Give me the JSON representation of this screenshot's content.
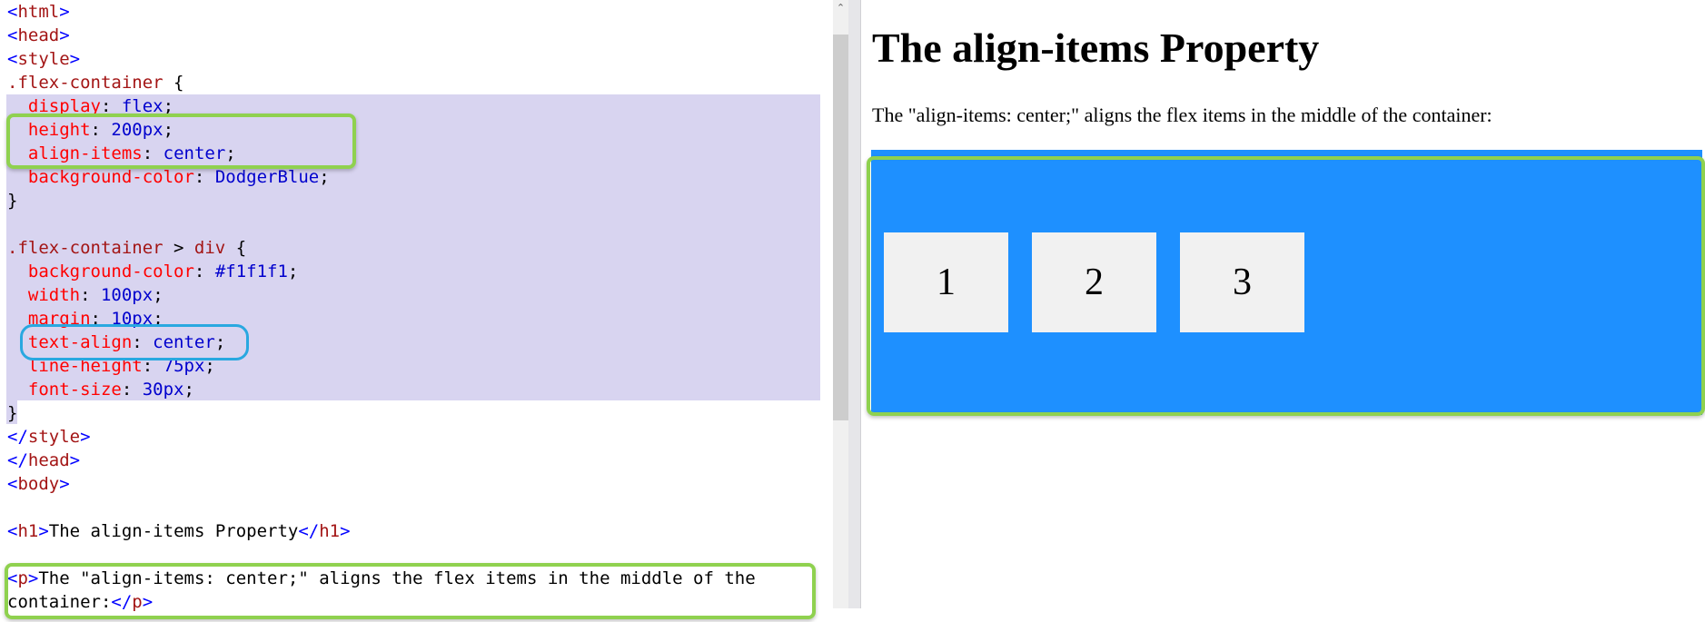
{
  "editor": {
    "lines": [
      [
        {
          "c": "b",
          "t": "<"
        },
        {
          "c": "g",
          "t": "html"
        },
        {
          "c": "b",
          "t": ">"
        }
      ],
      [
        {
          "c": "b",
          "t": "<"
        },
        {
          "c": "g",
          "t": "head"
        },
        {
          "c": "b",
          "t": ">"
        }
      ],
      [
        {
          "c": "b",
          "t": "<"
        },
        {
          "c": "g",
          "t": "style"
        },
        {
          "c": "b",
          "t": ">"
        }
      ],
      [
        {
          "c": "s",
          "t": ".flex-container"
        },
        {
          "c": "x",
          "t": " {"
        }
      ],
      [
        {
          "c": "x",
          "t": "  "
        },
        {
          "c": "p",
          "t": "display"
        },
        {
          "c": "x",
          "t": ": "
        },
        {
          "c": "v",
          "t": "flex"
        },
        {
          "c": "x",
          "t": ";"
        }
      ],
      [
        {
          "c": "x",
          "t": "  "
        },
        {
          "c": "p",
          "t": "height"
        },
        {
          "c": "x",
          "t": ": "
        },
        {
          "c": "v",
          "t": "200px"
        },
        {
          "c": "x",
          "t": ";"
        }
      ],
      [
        {
          "c": "x",
          "t": "  "
        },
        {
          "c": "p",
          "t": "align-items"
        },
        {
          "c": "x",
          "t": ": "
        },
        {
          "c": "v",
          "t": "center"
        },
        {
          "c": "x",
          "t": ";"
        }
      ],
      [
        {
          "c": "x",
          "t": "  "
        },
        {
          "c": "p",
          "t": "background-color"
        },
        {
          "c": "x",
          "t": ": "
        },
        {
          "c": "v",
          "t": "DodgerBlue"
        },
        {
          "c": "x",
          "t": ";"
        }
      ],
      [
        {
          "c": "x",
          "t": "}"
        }
      ],
      [
        {
          "c": "x",
          "t": ""
        }
      ],
      [
        {
          "c": "s",
          "t": ".flex-container"
        },
        {
          "c": "x",
          "t": " > "
        },
        {
          "c": "s",
          "t": "div"
        },
        {
          "c": "x",
          "t": " {"
        }
      ],
      [
        {
          "c": "x",
          "t": "  "
        },
        {
          "c": "p",
          "t": "background-color"
        },
        {
          "c": "x",
          "t": ": "
        },
        {
          "c": "v",
          "t": "#f1f1f1"
        },
        {
          "c": "x",
          "t": ";"
        }
      ],
      [
        {
          "c": "x",
          "t": "  "
        },
        {
          "c": "p",
          "t": "width"
        },
        {
          "c": "x",
          "t": ": "
        },
        {
          "c": "v",
          "t": "100px"
        },
        {
          "c": "x",
          "t": ";"
        }
      ],
      [
        {
          "c": "x",
          "t": "  "
        },
        {
          "c": "p",
          "t": "margin"
        },
        {
          "c": "x",
          "t": ": "
        },
        {
          "c": "v",
          "t": "10px"
        },
        {
          "c": "x",
          "t": ";"
        }
      ],
      [
        {
          "c": "x",
          "t": "  "
        },
        {
          "c": "p",
          "t": "text-align"
        },
        {
          "c": "x",
          "t": ": "
        },
        {
          "c": "v",
          "t": "center"
        },
        {
          "c": "x",
          "t": ";"
        }
      ],
      [
        {
          "c": "x",
          "t": "  "
        },
        {
          "c": "p",
          "t": "line-height"
        },
        {
          "c": "x",
          "t": ": "
        },
        {
          "c": "v",
          "t": "75px"
        },
        {
          "c": "x",
          "t": ";"
        }
      ],
      [
        {
          "c": "x",
          "t": "  "
        },
        {
          "c": "p",
          "t": "font-size"
        },
        {
          "c": "x",
          "t": ": "
        },
        {
          "c": "v",
          "t": "30px"
        },
        {
          "c": "x",
          "t": ";"
        }
      ],
      [
        {
          "c": "x",
          "t": "}"
        }
      ],
      [
        {
          "c": "b",
          "t": "</"
        },
        {
          "c": "g",
          "t": "style"
        },
        {
          "c": "b",
          "t": ">"
        }
      ],
      [
        {
          "c": "b",
          "t": "</"
        },
        {
          "c": "g",
          "t": "head"
        },
        {
          "c": "b",
          "t": ">"
        }
      ],
      [
        {
          "c": "b",
          "t": "<"
        },
        {
          "c": "g",
          "t": "body"
        },
        {
          "c": "b",
          "t": ">"
        }
      ],
      [
        {
          "c": "x",
          "t": ""
        }
      ],
      [
        {
          "c": "b",
          "t": "<"
        },
        {
          "c": "g",
          "t": "h1"
        },
        {
          "c": "b",
          "t": ">"
        },
        {
          "c": "x",
          "t": "The align-items Property"
        },
        {
          "c": "b",
          "t": "</"
        },
        {
          "c": "g",
          "t": "h1"
        },
        {
          "c": "b",
          "t": ">"
        }
      ],
      [
        {
          "c": "x",
          "t": ""
        }
      ],
      [
        {
          "c": "b",
          "t": "<"
        },
        {
          "c": "g",
          "t": "p"
        },
        {
          "c": "b",
          "t": ">"
        },
        {
          "c": "x",
          "t": "The \"align-items: center;\" aligns the flex items in the middle of the"
        }
      ],
      [
        {
          "c": "x",
          "t": "container:"
        },
        {
          "c": "b",
          "t": "</"
        },
        {
          "c": "g",
          "t": "p"
        },
        {
          "c": "b",
          "t": ">"
        }
      ]
    ],
    "highlight_color": "#d8d4f0"
  },
  "scrollbar": {
    "up_arrow_icon": "⌃"
  },
  "preview": {
    "heading": "The align-items Property",
    "paragraph": "The \"align-items: center;\" aligns the flex items in the middle of the container:",
    "container_color": "#1e90ff",
    "items": [
      "1",
      "2",
      "3"
    ]
  },
  "annotations": {
    "green": "#8fd14f",
    "blue": "#29a8e0"
  }
}
